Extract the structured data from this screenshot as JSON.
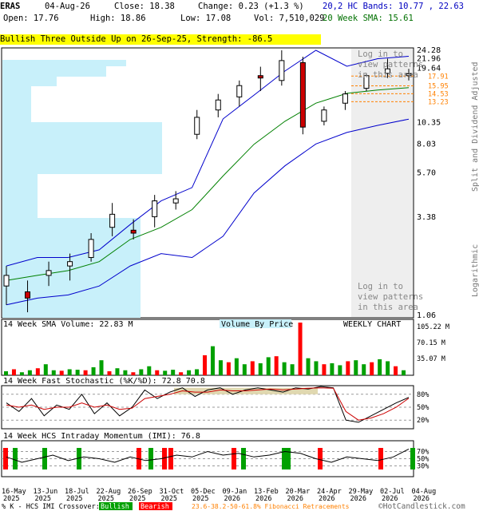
{
  "header": {
    "symbol": "ERAS",
    "date": "04-Aug-26",
    "close": "Close: 18.38",
    "change": "Change: 0.23 (+1.3 %)",
    "open": "Open: 17.76",
    "high": "High: 18.86",
    "low": "Low: 17.08",
    "volume": "Vol: 7,510,029",
    "hc_bands": "20,2 HC Bands: 10.77 , 22.63",
    "sma_label": "20 Week SMA: 15.61"
  },
  "pattern_banner": "Bullish Three Outside Up on 26-Sep-25, Strength: -86.5",
  "login_texts": [
    "Log in to view patterns in this area",
    "Log in to view patterns in this area"
  ],
  "right_axis_label": "Split and Dividend Adjusted",
  "log_label": "Logarithmic",
  "price_ticks": [
    "24.28",
    "21.96",
    "19.64",
    "10.35",
    "8.03",
    "5.70",
    "3.38",
    "1.06"
  ],
  "fib_labels": [
    "17.91",
    "15.95",
    "14.53",
    "13.23"
  ],
  "volume_panel": {
    "title": "14 Week SMA Volume: 22.83 M",
    "vbp_label": "Volume By Price",
    "weekly_label": "WEEKLY CHART",
    "ticks": [
      "105.22 M",
      "70.15 M",
      "35.07 M"
    ]
  },
  "stoch_panel": {
    "title": "14 Week Fast Stochastic (%K/%D): 72.8  70.8",
    "ticks": [
      "80%",
      "50%",
      "20%"
    ]
  },
  "imi_panel": {
    "title": "14 Week HCS Intraday Momentum (IMI): 76.8",
    "ticks": [
      "70%",
      "50%",
      "30%"
    ]
  },
  "x_labels": [
    [
      "16-May",
      "2025"
    ],
    [
      "13-Jun",
      "2025"
    ],
    [
      "18-Jul",
      "2025"
    ],
    [
      "22-Aug",
      "2025"
    ],
    [
      "26-Sep",
      "2025"
    ],
    [
      "31-Oct",
      "2025"
    ],
    [
      "05-Dec",
      "2025"
    ],
    [
      "09-Jan",
      "2026"
    ],
    [
      "13-Feb",
      "2026"
    ],
    [
      "20-Mar",
      "2026"
    ],
    [
      "24-Apr",
      "2026"
    ],
    [
      "29-May",
      "2026"
    ],
    [
      "02-Jul",
      "2026"
    ],
    [
      "04-Aug",
      "2026"
    ]
  ],
  "footer": {
    "legend_prefix": "% K - HCS IMI Crossover:",
    "bullish": "Bullish",
    "bearish": "Bearish",
    "fib_note": "23.6-38.2-50-61.8% Fibonacci Retracements",
    "credit": "©HotCandlestick.com"
  },
  "colors": {
    "up": "#ffffff",
    "down": "#cc0000",
    "bullish": "#00a000",
    "bearish": "#ff0000",
    "sma": "#008000",
    "bands": "#0000cc",
    "vbp": "#c8f0fa",
    "fib": "#ff8000"
  },
  "chart_data": [
    {
      "type": "candlestick",
      "title": "ERAS",
      "scale": "log",
      "ylim": [
        1.06,
        24.28
      ],
      "x": [
        "16-May-25",
        "13-Jun-25",
        "18-Jul-25",
        "22-Aug-25",
        "26-Sep-25",
        "31-Oct-25",
        "05-Dec-25",
        "09-Jan-26",
        "13-Feb-26",
        "20-Mar-26",
        "24-Apr-26",
        "29-May-26",
        "02-Jul-26",
        "04-Aug-26"
      ],
      "ohlc": [
        [
          1.5,
          1.9,
          1.2,
          1.7
        ],
        [
          1.4,
          1.6,
          1.1,
          1.3
        ],
        [
          1.7,
          2.0,
          1.5,
          1.8
        ],
        [
          1.9,
          2.2,
          1.6,
          2.0
        ],
        [
          2.1,
          2.8,
          2.0,
          2.6
        ],
        [
          3.0,
          4.0,
          2.7,
          3.5
        ],
        [
          2.9,
          3.3,
          2.6,
          2.8
        ],
        [
          3.4,
          4.4,
          3.0,
          4.1
        ],
        [
          4.0,
          4.6,
          3.7,
          4.2
        ],
        [
          9.0,
          12.0,
          8.5,
          11.0
        ],
        [
          12.0,
          14.5,
          11.0,
          13.5
        ],
        [
          14.0,
          17.0,
          12.5,
          16.0
        ],
        [
          18.0,
          20.0,
          15.0,
          17.5
        ],
        [
          17.0,
          24.28,
          16.0,
          21.5
        ],
        [
          21.0,
          22.5,
          9.0,
          9.8
        ],
        [
          10.5,
          12.5,
          10.0,
          12.0
        ],
        [
          13.0,
          15.0,
          12.0,
          14.5
        ],
        [
          15.5,
          18.5,
          15.0,
          18.0
        ],
        [
          18.5,
          22.0,
          17.5,
          19.5
        ],
        [
          18.0,
          19.5,
          17.0,
          18.38
        ]
      ],
      "sma20": [
        1.6,
        1.7,
        1.8,
        2.0,
        2.6,
        3.0,
        3.7,
        5.5,
        8.0,
        10.5,
        13.0,
        14.6,
        15.2,
        15.61
      ],
      "hc_upper": [
        1.9,
        2.1,
        2.1,
        2.3,
        3.1,
        4.1,
        4.8,
        10.8,
        14.3,
        19.0,
        24.28,
        20.1,
        22.0,
        22.63
      ],
      "hc_lower": [
        1.2,
        1.3,
        1.35,
        1.5,
        1.9,
        2.2,
        2.1,
        2.7,
        4.5,
        6.2,
        8.03,
        9.2,
        10.0,
        10.77
      ],
      "fib_retracements": [
        17.91,
        15.95,
        14.53,
        13.23
      ]
    },
    {
      "type": "bar",
      "title": "14 Week SMA Volume: 22.83 M",
      "ylim": [
        0,
        105.22
      ],
      "unit": "M",
      "values": [
        8,
        12,
        6,
        10,
        14,
        22,
        10,
        9,
        12,
        11,
        10,
        16,
        30,
        8,
        14,
        10,
        6,
        12,
        18,
        10,
        9,
        11,
        6,
        10,
        12,
        40,
        58,
        30,
        26,
        34,
        22,
        28,
        24,
        36,
        38,
        26,
        22,
        105.22,
        34,
        28,
        22,
        24,
        20,
        28,
        30,
        22,
        26,
        32,
        28,
        18,
        10
      ]
    },
    {
      "type": "line",
      "title": "14 Week Fast Stochastic (%K/%D): 72.8  70.8",
      "ylim": [
        0,
        100
      ],
      "series": [
        {
          "name": "%K",
          "values": [
            60,
            40,
            70,
            30,
            55,
            45,
            80,
            35,
            60,
            30,
            50,
            90,
            70,
            85,
            95,
            75,
            90,
            95,
            80,
            90,
            95,
            90,
            85,
            95,
            92,
            98,
            95,
            20,
            15,
            30,
            45,
            60,
            72.8
          ]
        },
        {
          "name": "%D",
          "values": [
            55,
            50,
            55,
            45,
            50,
            50,
            60,
            50,
            55,
            45,
            48,
            70,
            75,
            80,
            88,
            85,
            85,
            90,
            88,
            88,
            90,
            92,
            90,
            92,
            94,
            95,
            94,
            40,
            20,
            25,
            35,
            50,
            70.8
          ]
        }
      ]
    },
    {
      "type": "line",
      "title": "14 Week HCS Intraday Momentum (IMI): 76.8",
      "ylim": [
        0,
        100
      ],
      "series": [
        {
          "name": "IMI",
          "values": [
            55,
            40,
            50,
            60,
            45,
            55,
            50,
            40,
            55,
            45,
            50,
            60,
            55,
            70,
            60,
            65,
            55,
            60,
            70,
            65,
            50,
            40,
            55,
            50,
            45,
            55,
            76.8
          ]
        }
      ]
    }
  ]
}
